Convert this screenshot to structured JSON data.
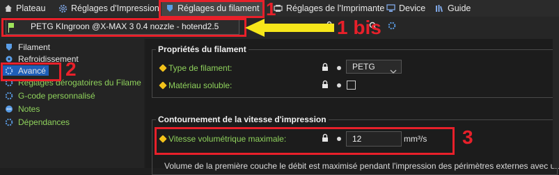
{
  "tabs": [
    {
      "label": "Plateau",
      "icon": "home-icon"
    },
    {
      "label": "Réglages d'Impression",
      "icon": "gear-icon"
    },
    {
      "label": "Réglages du filament",
      "icon": "filament-icon"
    },
    {
      "label": "Réglages de l'Imprimante",
      "icon": "printer-icon"
    },
    {
      "label": "Device",
      "icon": "device-icon"
    },
    {
      "label": "Guide",
      "icon": "guide-icon"
    }
  ],
  "preset": {
    "name": "PETG KIngroon @X-MAX 3 0.4 nozzle - hotend2.5"
  },
  "sidebar": {
    "items": [
      {
        "label": "Filament",
        "icon": "filament-icon"
      },
      {
        "label": "Refroidissement",
        "icon": "fan-icon"
      },
      {
        "label": "Avancé",
        "icon": "gear-icon"
      },
      {
        "label": "Réglages dérogatoires du Filame",
        "icon": "gear-icon"
      },
      {
        "label": "G-code personnalisé",
        "icon": "gear-icon"
      },
      {
        "label": "Notes",
        "icon": "notes-icon"
      },
      {
        "label": "Dépendances",
        "icon": "dependencies-icon"
      }
    ]
  },
  "groups": {
    "filament_props": {
      "title": "Propriétés du filament",
      "type_label": "Type de filament:",
      "type_value": "PETG",
      "soluble_label": "Matériau soluble:",
      "soluble_checked": false
    },
    "speed_bypass": {
      "title": "Contournement de la vitesse d'impression",
      "vol_label": "Vitesse volumétrique maximale:",
      "vol_value": "12",
      "vol_unit": "mm³/s",
      "description": "Volume de la première couche le débit est maximisé pendant l'impression des périmètres externes avec un"
    }
  },
  "annotations": {
    "n1": "1",
    "n1bis": "1 bis",
    "n2": "2",
    "n3": "3"
  },
  "colors": {
    "accent_green": "#8fd25c",
    "annotation_red": "#e8202a",
    "arrow_yellow": "#f6e61a",
    "option_dot": "#f2c21a"
  }
}
